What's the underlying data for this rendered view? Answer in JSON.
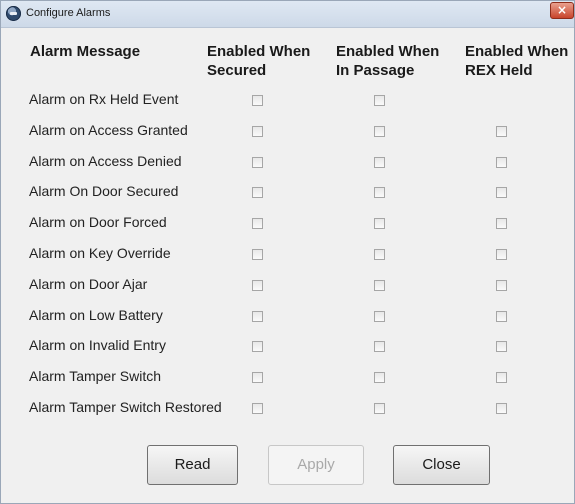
{
  "window": {
    "title": "Configure Alarms",
    "close_glyph": "×"
  },
  "headers": {
    "message": "Alarm Message",
    "secured_1": "Enabled When",
    "secured_2": "Secured",
    "passage_1": "Enabled When",
    "passage_2": "In Passage",
    "rex_1": "Enabled When",
    "rex_2": "REX Held"
  },
  "rows": [
    {
      "label": "Alarm on Rx Held Event",
      "secured": false,
      "passage": false,
      "rex": null
    },
    {
      "label": "Alarm on Access Granted",
      "secured": false,
      "passage": false,
      "rex": false
    },
    {
      "label": "Alarm on Access Denied",
      "secured": false,
      "passage": false,
      "rex": false
    },
    {
      "label": "Alarm On Door Secured",
      "secured": false,
      "passage": false,
      "rex": false
    },
    {
      "label": "Alarm on Door Forced",
      "secured": false,
      "passage": false,
      "rex": false
    },
    {
      "label": "Alarm on Key Override",
      "secured": false,
      "passage": false,
      "rex": false
    },
    {
      "label": "Alarm on Door Ajar",
      "secured": false,
      "passage": false,
      "rex": false
    },
    {
      "label": "Alarm on Low Battery",
      "secured": false,
      "passage": false,
      "rex": false
    },
    {
      "label": "Alarm on Invalid Entry",
      "secured": false,
      "passage": false,
      "rex": false
    },
    {
      "label": "Alarm Tamper Switch",
      "secured": false,
      "passage": false,
      "rex": false
    },
    {
      "label": "Alarm Tamper Switch Restored",
      "secured": false,
      "passage": false,
      "rex": false
    }
  ],
  "buttons": {
    "read": "Read",
    "apply": "Apply",
    "close": "Close",
    "apply_enabled": false
  }
}
